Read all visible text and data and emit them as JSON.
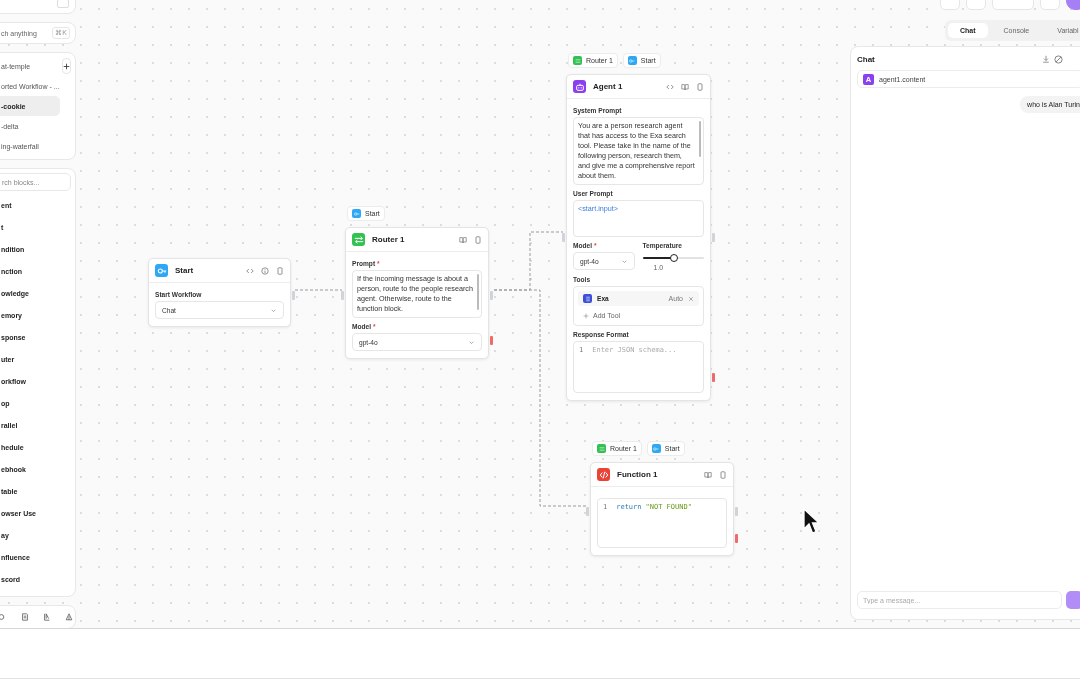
{
  "sidebar": {
    "search": {
      "placeholder": "ch anything",
      "shortcut": "⌘K"
    },
    "workflows": [
      {
        "name": "at-temple",
        "selected": false
      },
      {
        "name": "orted Workflow - ...",
        "selected": false
      },
      {
        "name": "-cookie",
        "selected": true
      },
      {
        "name": "-delta",
        "selected": false
      },
      {
        "name": "ing-waterfall",
        "selected": false
      }
    ],
    "block_search": {
      "placeholder": "rch blocks..."
    },
    "blocks": [
      "ent",
      "t",
      "ndition",
      "nction",
      "owledge",
      "emory",
      "sponse",
      "uter",
      "orkflow",
      "op",
      "rallel",
      "hedule",
      "ebhook",
      "table",
      "owser Use",
      "ay",
      "nfluence",
      "scord"
    ]
  },
  "canvas": {
    "nodes": [
      {
        "kind": "start",
        "title": "Start",
        "color": "#2ea8f4",
        "actions": [
          {
            "kind": "code"
          },
          {
            "kind": "info"
          },
          {
            "kind": "delete"
          }
        ],
        "fields": [
          {
            "kind": "select",
            "label": "Start Workflow",
            "value": "Chat"
          }
        ]
      },
      {
        "kind": "router",
        "title": "Router 1",
        "color": "#33c152",
        "tags": [
          {
            "label": "Start",
            "color": "#2ea8f4",
            "kind": "start"
          }
        ],
        "actions": [
          {
            "kind": "book"
          },
          {
            "kind": "delete"
          }
        ],
        "fields": [
          {
            "kind": "textarea",
            "label": "Prompt",
            "required_mark": "*",
            "value": "If the incoming message is about a person, route to the people research agent. Otherwise, route to the function block."
          },
          {
            "kind": "select",
            "label": "Model",
            "required_mark": "*",
            "value": "gpt-4o"
          }
        ]
      },
      {
        "kind": "agent",
        "title": "Agent 1",
        "color": "#8a3ff0",
        "tags": [
          {
            "label": "Router 1",
            "color": "#33c152",
            "kind": "router"
          },
          {
            "label": "Start",
            "color": "#2ea8f4",
            "kind": "start"
          }
        ],
        "actions": [
          {
            "kind": "code"
          },
          {
            "kind": "book"
          },
          {
            "kind": "delete"
          }
        ],
        "fields": [
          {
            "kind": "textarea",
            "label": "System Prompt",
            "value": "You are a person research agent that has access to the Exa search tool. Please take in the name of the following person, research them, and give me a comprehensive report about them."
          },
          {
            "kind": "reference",
            "label": "User Prompt",
            "value": "<start.input>"
          },
          {
            "kind": "model_temperature",
            "model": {
              "label": "Model",
              "required_mark": "*",
              "value": "gpt-4o"
            },
            "temperature": {
              "label": "Temperature",
              "level": 1,
              "reading": "1.0"
            }
          },
          {
            "kind": "tools",
            "label": "Tools",
            "tools": [
              {
                "name": "Exa",
                "color": "#3b4fd8",
                "mode": "Auto"
              }
            ],
            "add": "Add Tool"
          },
          {
            "kind": "code",
            "label": "Response Format",
            "lines": [
              {
                "number": "1",
                "placeholder": "Enter JSON schema..."
              }
            ]
          }
        ]
      },
      {
        "kind": "function",
        "title": "Function 1",
        "color": "#ea4335",
        "tags": [
          {
            "label": "Router 1",
            "color": "#33c152",
            "kind": "router"
          },
          {
            "label": "Start",
            "color": "#2ea8f4",
            "kind": "start"
          }
        ],
        "actions": [
          {
            "kind": "book"
          },
          {
            "kind": "delete"
          }
        ],
        "fields": [
          {
            "kind": "code",
            "lines": [
              {
                "number": "1",
                "tokens": [
                  {
                    "text": "return",
                    "kind": "keyword"
                  },
                  {
                    "text": "\"NOT FOUND\"",
                    "kind": "string"
                  }
                ]
              }
            ]
          }
        ]
      }
    ]
  },
  "panel": {
    "tabs": [
      {
        "label": "Chat",
        "selected": true
      },
      {
        "label": "Console",
        "selected": false
      },
      {
        "label": "Variabl",
        "selected": false
      }
    ],
    "chat": {
      "title": "Chat",
      "output": {
        "badge": "A",
        "value": "agent1.content"
      },
      "messages": [
        {
          "text": "who is Alan Turin"
        }
      ],
      "input": {
        "placeholder": "Type a message..."
      }
    }
  }
}
